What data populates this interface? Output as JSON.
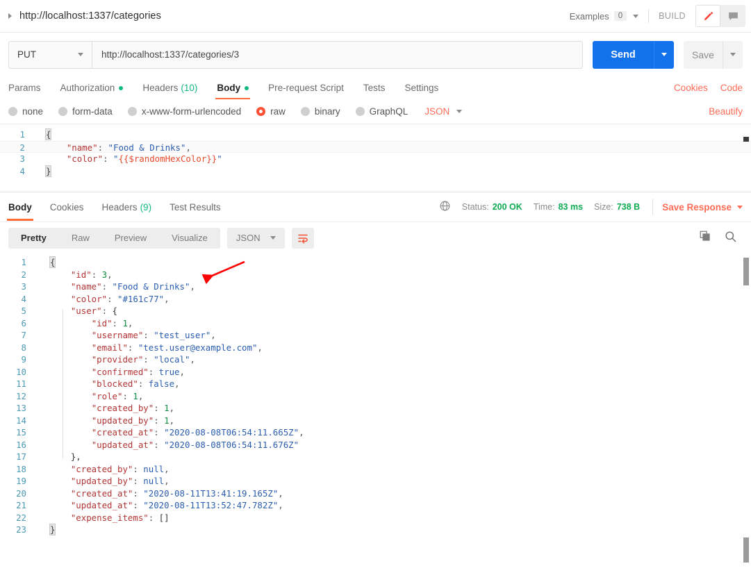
{
  "topbar": {
    "request_title": "http://localhost:1337/categories",
    "examples_label": "Examples",
    "examples_count": "0",
    "build_label": "BUILD",
    "edit_icon": "pencil-icon",
    "comment_icon": "comment-icon"
  },
  "urlbar": {
    "method": "PUT",
    "url": "http://localhost:1337/categories/3",
    "send_label": "Send",
    "save_label": "Save"
  },
  "request_tabs": {
    "items": [
      {
        "label": "Params",
        "dot": false,
        "count": ""
      },
      {
        "label": "Authorization",
        "dot": true,
        "count": ""
      },
      {
        "label": "Headers",
        "dot": false,
        "count": "(10)"
      },
      {
        "label": "Body",
        "dot": true,
        "count": ""
      },
      {
        "label": "Pre-request Script",
        "dot": false,
        "count": ""
      },
      {
        "label": "Tests",
        "dot": false,
        "count": ""
      },
      {
        "label": "Settings",
        "dot": false,
        "count": ""
      }
    ],
    "active": "Body",
    "cookies_link": "Cookies",
    "code_link": "Code"
  },
  "body_type": {
    "options": [
      {
        "label": "none",
        "selected": false
      },
      {
        "label": "form-data",
        "selected": false
      },
      {
        "label": "x-www-form-urlencoded",
        "selected": false
      },
      {
        "label": "raw",
        "selected": true
      },
      {
        "label": "binary",
        "selected": false
      },
      {
        "label": "GraphQL",
        "selected": false
      }
    ],
    "format": "JSON",
    "beautify_label": "Beautify"
  },
  "request_body": {
    "lines": [
      {
        "n": "1",
        "parts": [
          {
            "t": "{",
            "c": "brace-box"
          }
        ]
      },
      {
        "n": "2",
        "highlight": true,
        "parts": [
          {
            "t": "    ",
            "c": "p"
          },
          {
            "t": "\"name\"",
            "c": "k"
          },
          {
            "t": ": ",
            "c": "p"
          },
          {
            "t": "\"Food & Drinks\"",
            "c": "s"
          },
          {
            "t": ",",
            "c": "p"
          }
        ]
      },
      {
        "n": "3",
        "parts": [
          {
            "t": "    ",
            "c": "p"
          },
          {
            "t": "\"color\"",
            "c": "k"
          },
          {
            "t": ": ",
            "c": "p"
          },
          {
            "t": "\"",
            "c": "s"
          },
          {
            "t": "{{$randomHexColor}}",
            "c": "var"
          },
          {
            "t": "\"",
            "c": "s"
          }
        ]
      },
      {
        "n": "4",
        "parts": [
          {
            "t": "}",
            "c": "brace-box"
          }
        ]
      }
    ]
  },
  "response_header": {
    "tabs": [
      {
        "label": "Body",
        "count": ""
      },
      {
        "label": "Cookies",
        "count": ""
      },
      {
        "label": "Headers",
        "count": "(9)"
      },
      {
        "label": "Test Results",
        "count": ""
      }
    ],
    "active": "Body",
    "globe_icon": "globe-icon",
    "status_label": "Status:",
    "status_value": "200 OK",
    "time_label": "Time:",
    "time_value": "83 ms",
    "size_label": "Size:",
    "size_value": "738 B",
    "save_response_label": "Save Response"
  },
  "response_tools": {
    "view_modes": [
      "Pretty",
      "Raw",
      "Preview",
      "Visualize"
    ],
    "active_mode": "Pretty",
    "format": "JSON",
    "wrap_icon": "wrap-lines-icon",
    "copy_icon": "copy-icon",
    "search_icon": "search-icon"
  },
  "response_body": {
    "lines": [
      {
        "n": "1",
        "parts": [
          {
            "t": "{",
            "c": "brace-box"
          }
        ]
      },
      {
        "n": "2",
        "parts": [
          {
            "t": "    ",
            "c": "p"
          },
          {
            "t": "\"id\"",
            "c": "k"
          },
          {
            "t": ": ",
            "c": "p"
          },
          {
            "t": "3",
            "c": "num"
          },
          {
            "t": ",",
            "c": "p"
          }
        ]
      },
      {
        "n": "3",
        "parts": [
          {
            "t": "    ",
            "c": "p"
          },
          {
            "t": "\"name\"",
            "c": "k"
          },
          {
            "t": ": ",
            "c": "p"
          },
          {
            "t": "\"Food & Drinks\"",
            "c": "s"
          },
          {
            "t": ",",
            "c": "p"
          }
        ]
      },
      {
        "n": "4",
        "parts": [
          {
            "t": "    ",
            "c": "p"
          },
          {
            "t": "\"color\"",
            "c": "k"
          },
          {
            "t": ": ",
            "c": "p"
          },
          {
            "t": "\"#161c77\"",
            "c": "s"
          },
          {
            "t": ",",
            "c": "p"
          }
        ]
      },
      {
        "n": "5",
        "parts": [
          {
            "t": "    ",
            "c": "p"
          },
          {
            "t": "\"user\"",
            "c": "k"
          },
          {
            "t": ": ",
            "c": "p"
          },
          {
            "t": "{",
            "c": "brace"
          }
        ]
      },
      {
        "n": "6",
        "parts": [
          {
            "t": "        ",
            "c": "p"
          },
          {
            "t": "\"id\"",
            "c": "k"
          },
          {
            "t": ": ",
            "c": "p"
          },
          {
            "t": "1",
            "c": "num"
          },
          {
            "t": ",",
            "c": "p"
          }
        ]
      },
      {
        "n": "7",
        "parts": [
          {
            "t": "        ",
            "c": "p"
          },
          {
            "t": "\"username\"",
            "c": "k"
          },
          {
            "t": ": ",
            "c": "p"
          },
          {
            "t": "\"test_user\"",
            "c": "s"
          },
          {
            "t": ",",
            "c": "p"
          }
        ]
      },
      {
        "n": "8",
        "parts": [
          {
            "t": "        ",
            "c": "p"
          },
          {
            "t": "\"email\"",
            "c": "k"
          },
          {
            "t": ": ",
            "c": "p"
          },
          {
            "t": "\"test.user@example.com\"",
            "c": "s"
          },
          {
            "t": ",",
            "c": "p"
          }
        ]
      },
      {
        "n": "9",
        "parts": [
          {
            "t": "        ",
            "c": "p"
          },
          {
            "t": "\"provider\"",
            "c": "k"
          },
          {
            "t": ": ",
            "c": "p"
          },
          {
            "t": "\"local\"",
            "c": "s"
          },
          {
            "t": ",",
            "c": "p"
          }
        ]
      },
      {
        "n": "10",
        "parts": [
          {
            "t": "        ",
            "c": "p"
          },
          {
            "t": "\"confirmed\"",
            "c": "k"
          },
          {
            "t": ": ",
            "c": "p"
          },
          {
            "t": "true",
            "c": "bool"
          },
          {
            "t": ",",
            "c": "p"
          }
        ]
      },
      {
        "n": "11",
        "parts": [
          {
            "t": "        ",
            "c": "p"
          },
          {
            "t": "\"blocked\"",
            "c": "k"
          },
          {
            "t": ": ",
            "c": "p"
          },
          {
            "t": "false",
            "c": "bool"
          },
          {
            "t": ",",
            "c": "p"
          }
        ]
      },
      {
        "n": "12",
        "parts": [
          {
            "t": "        ",
            "c": "p"
          },
          {
            "t": "\"role\"",
            "c": "k"
          },
          {
            "t": ": ",
            "c": "p"
          },
          {
            "t": "1",
            "c": "num"
          },
          {
            "t": ",",
            "c": "p"
          }
        ]
      },
      {
        "n": "13",
        "parts": [
          {
            "t": "        ",
            "c": "p"
          },
          {
            "t": "\"created_by\"",
            "c": "k"
          },
          {
            "t": ": ",
            "c": "p"
          },
          {
            "t": "1",
            "c": "num"
          },
          {
            "t": ",",
            "c": "p"
          }
        ]
      },
      {
        "n": "14",
        "parts": [
          {
            "t": "        ",
            "c": "p"
          },
          {
            "t": "\"updated_by\"",
            "c": "k"
          },
          {
            "t": ": ",
            "c": "p"
          },
          {
            "t": "1",
            "c": "num"
          },
          {
            "t": ",",
            "c": "p"
          }
        ]
      },
      {
        "n": "15",
        "parts": [
          {
            "t": "        ",
            "c": "p"
          },
          {
            "t": "\"created_at\"",
            "c": "k"
          },
          {
            "t": ": ",
            "c": "p"
          },
          {
            "t": "\"2020-08-08T06:54:11.665Z\"",
            "c": "s"
          },
          {
            "t": ",",
            "c": "p"
          }
        ]
      },
      {
        "n": "16",
        "parts": [
          {
            "t": "        ",
            "c": "p"
          },
          {
            "t": "\"updated_at\"",
            "c": "k"
          },
          {
            "t": ": ",
            "c": "p"
          },
          {
            "t": "\"2020-08-08T06:54:11.676Z\"",
            "c": "s"
          }
        ]
      },
      {
        "n": "17",
        "parts": [
          {
            "t": "    ",
            "c": "p"
          },
          {
            "t": "},",
            "c": "brace"
          }
        ]
      },
      {
        "n": "18",
        "parts": [
          {
            "t": "    ",
            "c": "p"
          },
          {
            "t": "\"created_by\"",
            "c": "k"
          },
          {
            "t": ": ",
            "c": "p"
          },
          {
            "t": "null",
            "c": "nul"
          },
          {
            "t": ",",
            "c": "p"
          }
        ]
      },
      {
        "n": "19",
        "parts": [
          {
            "t": "    ",
            "c": "p"
          },
          {
            "t": "\"updated_by\"",
            "c": "k"
          },
          {
            "t": ": ",
            "c": "p"
          },
          {
            "t": "null",
            "c": "nul"
          },
          {
            "t": ",",
            "c": "p"
          }
        ]
      },
      {
        "n": "20",
        "parts": [
          {
            "t": "    ",
            "c": "p"
          },
          {
            "t": "\"created_at\"",
            "c": "k"
          },
          {
            "t": ": ",
            "c": "p"
          },
          {
            "t": "\"2020-08-11T13:41:19.165Z\"",
            "c": "s"
          },
          {
            "t": ",",
            "c": "p"
          }
        ]
      },
      {
        "n": "21",
        "parts": [
          {
            "t": "    ",
            "c": "p"
          },
          {
            "t": "\"updated_at\"",
            "c": "k"
          },
          {
            "t": ": ",
            "c": "p"
          },
          {
            "t": "\"2020-08-11T13:52:47.782Z\"",
            "c": "s"
          },
          {
            "t": ",",
            "c": "p"
          }
        ]
      },
      {
        "n": "22",
        "parts": [
          {
            "t": "    ",
            "c": "p"
          },
          {
            "t": "\"expense_items\"",
            "c": "k"
          },
          {
            "t": ": ",
            "c": "p"
          },
          {
            "t": "[]",
            "c": "brace"
          }
        ]
      },
      {
        "n": "23",
        "parts": [
          {
            "t": "}",
            "c": "brace-box"
          }
        ]
      }
    ]
  },
  "annotation": {
    "arrow_color": "#ff0000",
    "arrow_name": "red-arrow-annotation"
  },
  "colors": {
    "accent_orange": "#ff6c37",
    "send_blue": "#1272ec",
    "status_green": "#0cab52"
  }
}
